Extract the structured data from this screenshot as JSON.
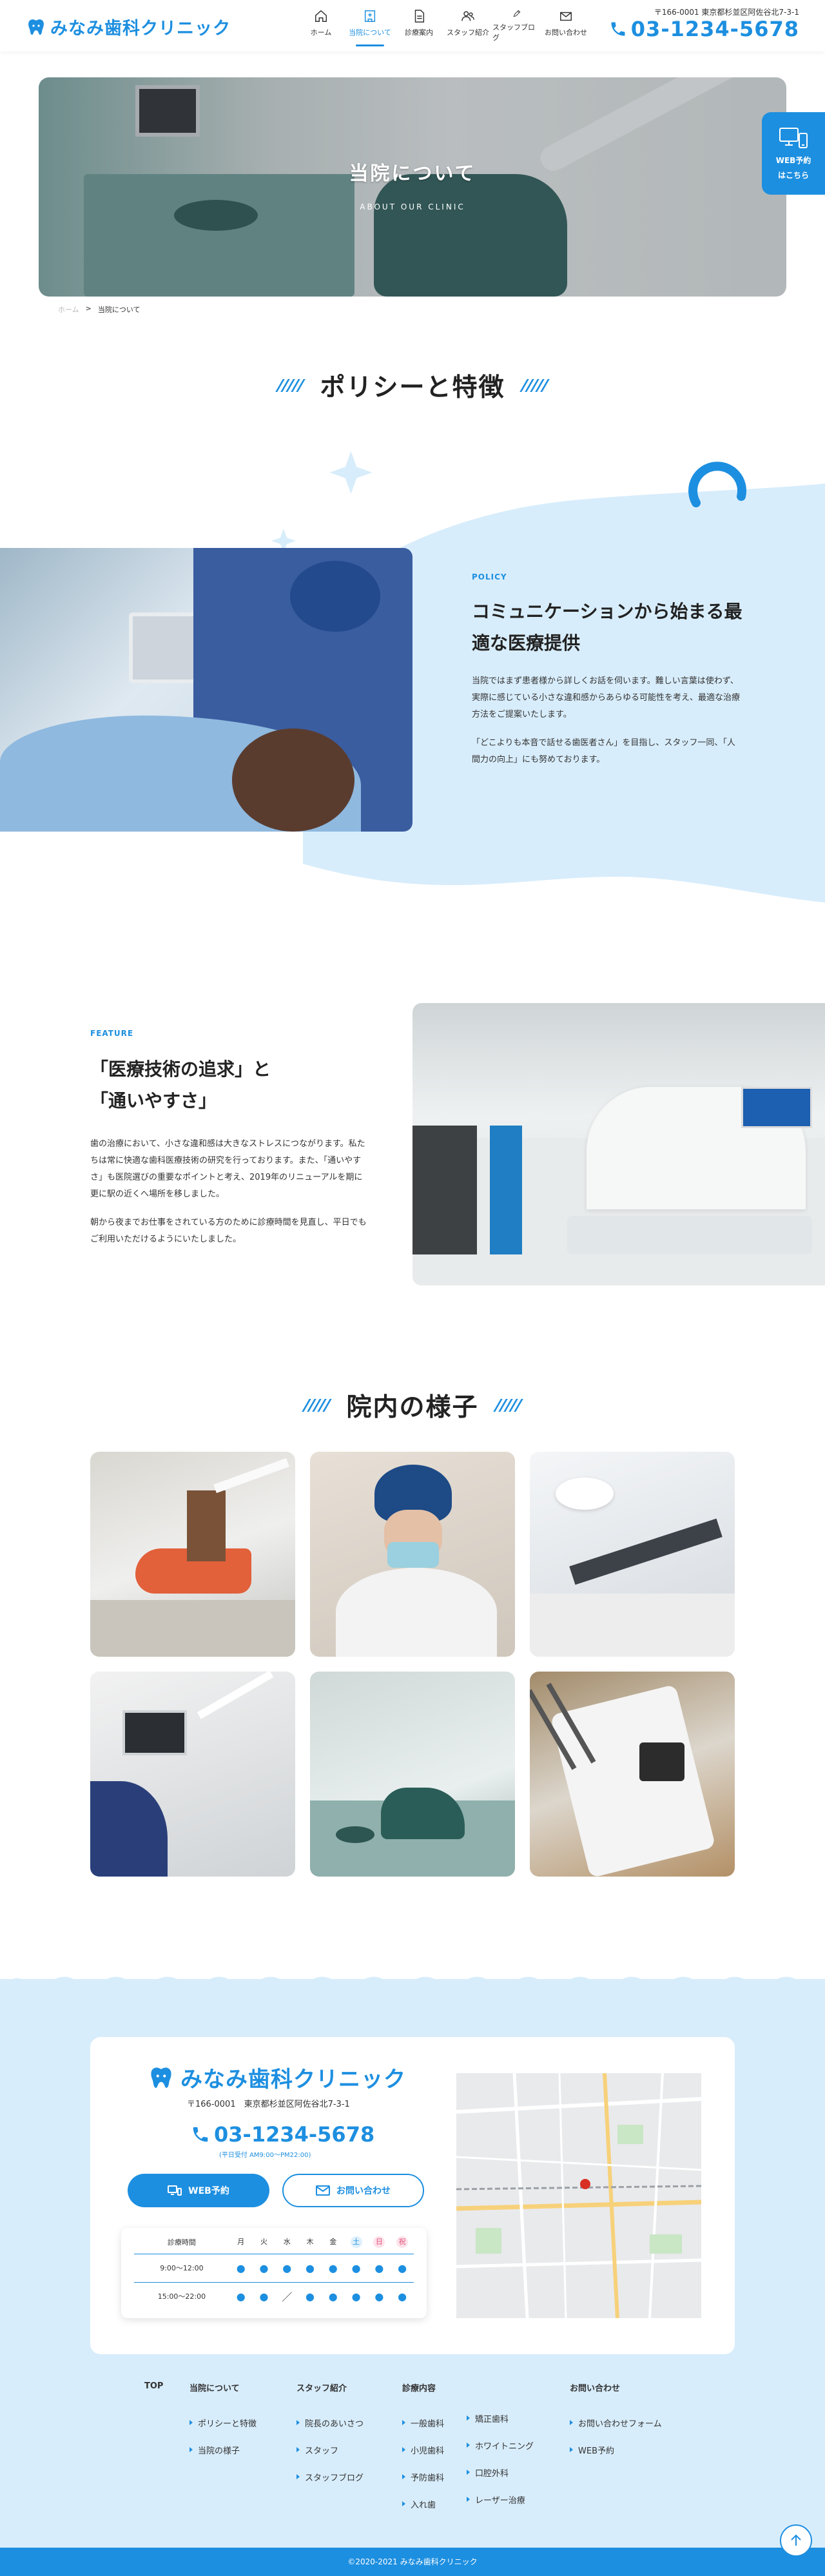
{
  "brand": {
    "name": "みなみ歯科クリニック",
    "accent": "#1d8fe0"
  },
  "header": {
    "nav": [
      {
        "label": "ホーム",
        "icon": "home-icon"
      },
      {
        "label": "当院について",
        "icon": "clinic-icon"
      },
      {
        "label": "診療案内",
        "icon": "document-icon"
      },
      {
        "label": "スタッフ紹介",
        "icon": "staff-icon"
      },
      {
        "label": "スタッフブログ",
        "icon": "pencil-icon"
      },
      {
        "label": "お問い合わせ",
        "icon": "mail-icon"
      }
    ],
    "address": "〒166-0001 東京都杉並区阿佐谷北7-3-1",
    "tel": "03-1234-5678"
  },
  "side_booking": {
    "line1": "WEB予約",
    "line2": "はこちら"
  },
  "hero": {
    "title": "当院について",
    "subtitle": "ABOUT OUR CLINIC"
  },
  "breadcrumb": {
    "home": "ホーム",
    "separator": ">",
    "current": "当院について"
  },
  "policy": {
    "heading": "ポリシーと特徴",
    "label": "POLICY",
    "title": "コミュニケーションから始まる最適な医療提供",
    "p1": "当院ではまず患者様から詳しくお話を伺います。難しい言葉は使わず、実際に感じている小さな違和感からあらゆる可能性を考え、最適な治療方法をご提案いたします。",
    "p2": "「どこよりも本音で話せる歯医者さん」を目指し、スタッフ一同、「人間力の向上」にも努めております。"
  },
  "feature": {
    "label": "FEATURE",
    "title_line1": "「医療技術の追求」と",
    "title_line2": "「通いやすさ」",
    "p1": "歯の治療において、小さな違和感は大きなストレスにつながります。私たちは常に快適な歯科医療技術の研究を行っております。また、「通いやすさ」も医院選びの重要なポイントと考え、2019年のリニューアルを期に更に駅の近くへ場所を移しました。",
    "p2": "朝から夜までお仕事をされている方のために診療時間を見直し、平日でもご利用いただけるようにいたしました。"
  },
  "gallery": {
    "heading": "院内の様子"
  },
  "contact": {
    "clinic_name": "みなみ歯科クリニック",
    "address": "〒166-0001　東京都杉並区阿佐谷北7-3-1",
    "tel": "03-1234-5678",
    "hours_note": "(平日受付 AM9:00〜PM22:00)",
    "web_button": "WEB予約",
    "mail_button": "お問い合わせ",
    "hours": {
      "header": [
        "診療時間",
        "月",
        "火",
        "水",
        "木",
        "金",
        "土",
        "日",
        "祝"
      ],
      "rows": [
        {
          "time": "9:00〜12:00",
          "marks": [
            "●",
            "●",
            "●",
            "●",
            "●",
            "●",
            "●",
            "●"
          ]
        },
        {
          "time": "15:00〜22:00",
          "marks": [
            "●",
            "●",
            "／",
            "●",
            "●",
            "●",
            "●",
            "●"
          ]
        }
      ]
    }
  },
  "footer_nav": {
    "top": "TOP",
    "about": {
      "head": "当院について",
      "links": [
        "ポリシーと特徴",
        "当院の様子"
      ]
    },
    "staff": {
      "head": "スタッフ紹介",
      "links": [
        "院長のあいさつ",
        "スタッフ",
        "スタッフブログ"
      ]
    },
    "treatment": {
      "head": "診療内容",
      "col1": [
        "一般歯科",
        "小児歯科",
        "予防歯科",
        "入れ歯"
      ],
      "col2": [
        "矯正歯科",
        "ホワイトニング",
        "口腔外科",
        "レーザー治療"
      ]
    },
    "contact": {
      "head": "お問い合わせ",
      "links": [
        "お問い合わせフォーム",
        "WEB予約"
      ]
    }
  },
  "copyright": "©2020-2021 みなみ歯科クリニック"
}
